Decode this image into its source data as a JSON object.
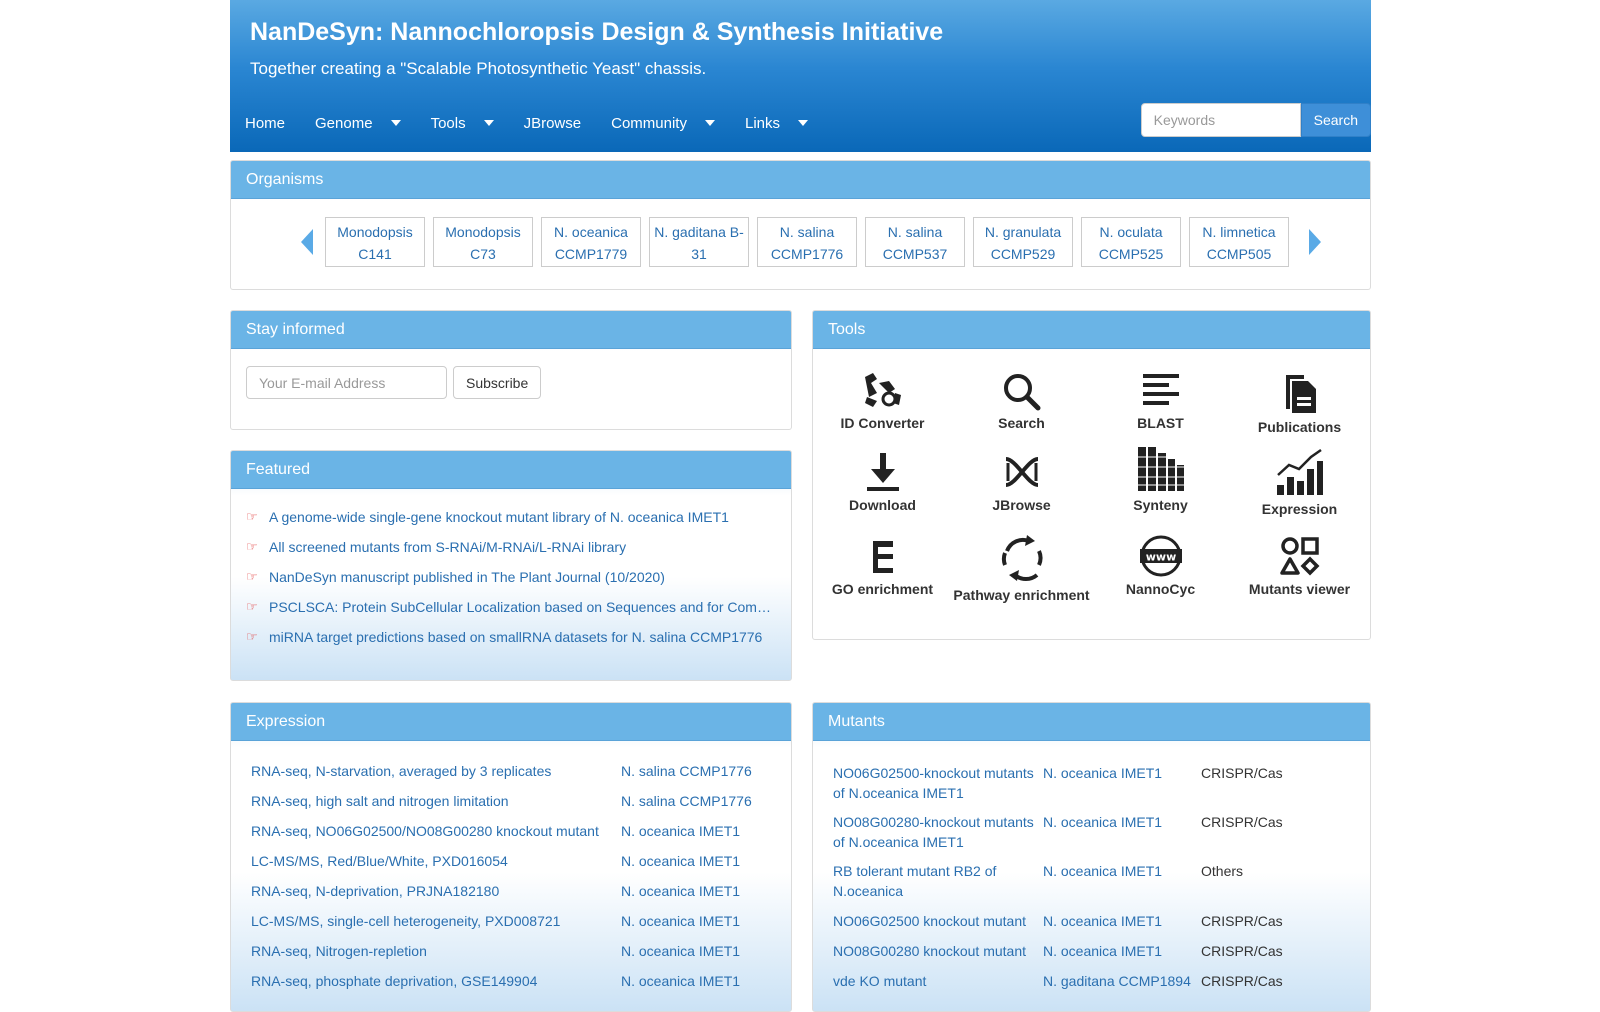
{
  "header": {
    "title": "NanDeSyn: Nannochloropsis Design & Synthesis Initiative",
    "slogan": "Together creating a \"Scalable Photosynthetic Yeast\" chassis."
  },
  "nav": {
    "items": [
      {
        "label": "Home",
        "dropdown": false
      },
      {
        "label": "Genome",
        "dropdown": true
      },
      {
        "label": "Tools",
        "dropdown": true
      },
      {
        "label": "JBrowse",
        "dropdown": false
      },
      {
        "label": "Community",
        "dropdown": true
      },
      {
        "label": "Links",
        "dropdown": true
      }
    ],
    "search_placeholder": "Keywords",
    "search_label": "Search"
  },
  "organisms": {
    "title": "Organisms",
    "items": [
      {
        "line1": "Monodopsis",
        "line2": "C141"
      },
      {
        "line1": "Monodopsis",
        "line2": "C73"
      },
      {
        "line1": "N. oceanica",
        "line2": "CCMP1779"
      },
      {
        "line1": "N. gaditana B-",
        "line2": "31"
      },
      {
        "line1": "N. salina",
        "line2": "CCMP1776"
      },
      {
        "line1": "N. salina",
        "line2": "CCMP537"
      },
      {
        "line1": "N. granulata",
        "line2": "CCMP529"
      },
      {
        "line1": "N. oculata",
        "line2": "CCMP525"
      },
      {
        "line1": "N. limnetica",
        "line2": "CCMP505"
      }
    ]
  },
  "stay_informed": {
    "title": "Stay informed",
    "email_placeholder": "Your E-mail Address",
    "subscribe_label": "Subscribe"
  },
  "featured": {
    "title": "Featured",
    "bullet": "☞",
    "items": [
      "A genome-wide single-gene knockout mutant library of N. oceanica IMET1",
      "All screened mutants from S-RNAi/M-RNAi/L-RNAi library",
      "NanDeSyn manuscript published in The Plant Journal (10/2020)",
      "PSCLSCA: Protein SubCellular Localization based on Sequences and for Comparative Analysis",
      "miRNA target predictions based on smallRNA datasets for N. salina CCMP1776"
    ]
  },
  "tools": {
    "title": "Tools",
    "items": [
      {
        "label": "ID Converter",
        "icon": "id-converter-icon"
      },
      {
        "label": "Search",
        "icon": "magnifier-icon"
      },
      {
        "label": "BLAST",
        "icon": "align-lines-icon"
      },
      {
        "label": "Publications",
        "icon": "documents-icon"
      },
      {
        "label": "Download",
        "icon": "download-icon"
      },
      {
        "label": "JBrowse",
        "icon": "dna-icon"
      },
      {
        "label": "Synteny",
        "icon": "synteny-icon"
      },
      {
        "label": "Expression",
        "icon": "bar-trend-icon"
      },
      {
        "label": "GO enrichment",
        "icon": "hierarchy-icon"
      },
      {
        "label": "Pathway enrichment",
        "icon": "cycle-arrows-icon"
      },
      {
        "label": "NannoCyc",
        "icon": "www-globe-icon"
      },
      {
        "label": "Mutants viewer",
        "icon": "shapes-icon"
      }
    ]
  },
  "expression": {
    "title": "Expression",
    "rows": [
      {
        "name": "RNA-seq, N-starvation, averaged by 3 replicates",
        "organism": "N. salina CCMP1776"
      },
      {
        "name": "RNA-seq, high salt and nitrogen limitation",
        "organism": "N. salina CCMP1776"
      },
      {
        "name": "RNA-seq, NO06G02500/NO08G00280 knockout mutant",
        "organism": "N. oceanica IMET1"
      },
      {
        "name": "LC-MS/MS, Red/Blue/White, PXD016054",
        "organism": "N. oceanica IMET1"
      },
      {
        "name": "RNA-seq, N-deprivation, PRJNA182180",
        "organism": "N. oceanica IMET1"
      },
      {
        "name": "LC-MS/MS, single-cell heterogeneity, PXD008721",
        "organism": "N. oceanica IMET1"
      },
      {
        "name": "RNA-seq, Nitrogen-repletion",
        "organism": "N. oceanica IMET1"
      },
      {
        "name": "RNA-seq, phosphate deprivation, GSE149904",
        "organism": "N. oceanica IMET1"
      }
    ]
  },
  "mutants": {
    "title": "Mutants",
    "rows": [
      {
        "name": "NO06G02500-knockout mutants of N.oceanica IMET1",
        "organism": "N. oceanica IMET1",
        "type": "CRISPR/Cas",
        "two_line": true
      },
      {
        "name": "NO08G00280-knockout mutants of N.oceanica IMET1",
        "organism": "N. oceanica IMET1",
        "type": "CRISPR/Cas",
        "two_line": true
      },
      {
        "name": "RB tolerant mutant RB2 of N.oceanica",
        "organism": "N. oceanica IMET1",
        "type": "Others",
        "two_line": true
      },
      {
        "name": "NO06G02500 knockout mutant",
        "organism": "N. oceanica IMET1",
        "type": "CRISPR/Cas",
        "two_line": false
      },
      {
        "name": "NO08G00280 knockout mutant",
        "organism": "N. oceanica IMET1",
        "type": "CRISPR/Cas",
        "two_line": false
      },
      {
        "name": "vde KO mutant",
        "organism": "N. gaditana CCMP1894",
        "type": "CRISPR/Cas",
        "two_line": false
      }
    ]
  },
  "colors": {
    "header_top": "#5aa9e2",
    "header_bottom": "#0a68b8",
    "panel_heading": "#6ab4e6",
    "link": "#2a6fb0",
    "bullet": "#e03030"
  }
}
